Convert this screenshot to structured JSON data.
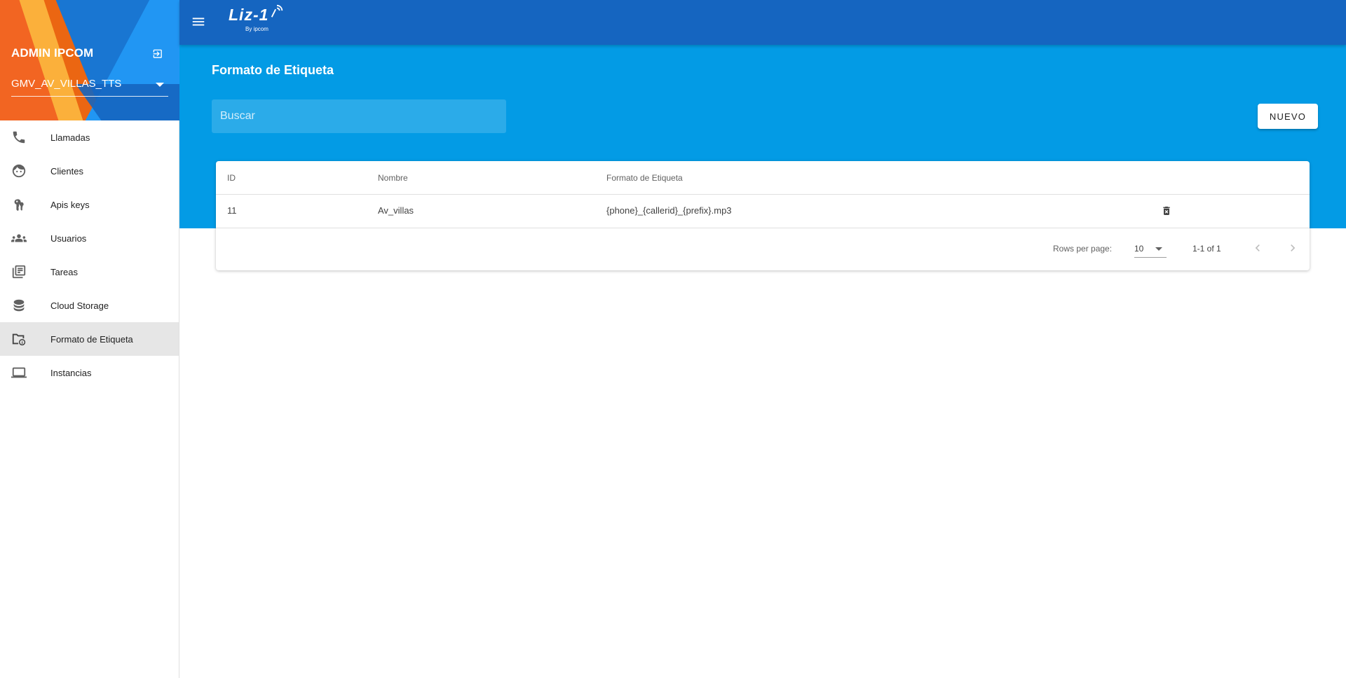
{
  "sidebar": {
    "admin_title": "ADMIN IPCOM",
    "account": "GMV_AV_VILLAS_TTS",
    "items": [
      {
        "label": "Llamadas",
        "icon": "phone-icon"
      },
      {
        "label": "Clientes",
        "icon": "face-icon"
      },
      {
        "label": "Apis keys",
        "icon": "key-icon"
      },
      {
        "label": "Usuarios",
        "icon": "people-icon"
      },
      {
        "label": "Tareas",
        "icon": "task-list-icon"
      },
      {
        "label": "Cloud Storage",
        "icon": "database-icon"
      },
      {
        "label": "Formato de Etiqueta",
        "icon": "folder-info-icon",
        "active": true
      },
      {
        "label": "Instancias",
        "icon": "computer-icon"
      }
    ]
  },
  "topbar": {
    "brand_name": "Liz-1",
    "brand_sub": "By ipcom"
  },
  "main": {
    "title": "Formato de Etiqueta",
    "search_placeholder": "Buscar",
    "new_label": "NUEVO"
  },
  "table": {
    "columns": [
      "ID",
      "Nombre",
      "Formato de Etiqueta"
    ],
    "rows": [
      {
        "id": "11",
        "nombre": "Av_villas",
        "formato": "{phone}_{callerid}_{prefix}.mp3"
      }
    ],
    "pagination": {
      "rows_per_page_label": "Rows per page:",
      "rows_per_page": "10",
      "range": "1-1 of 1"
    }
  },
  "colors": {
    "topbar": "#1565c0",
    "banner": "#039be5",
    "active_item": "#e6e6e6"
  }
}
